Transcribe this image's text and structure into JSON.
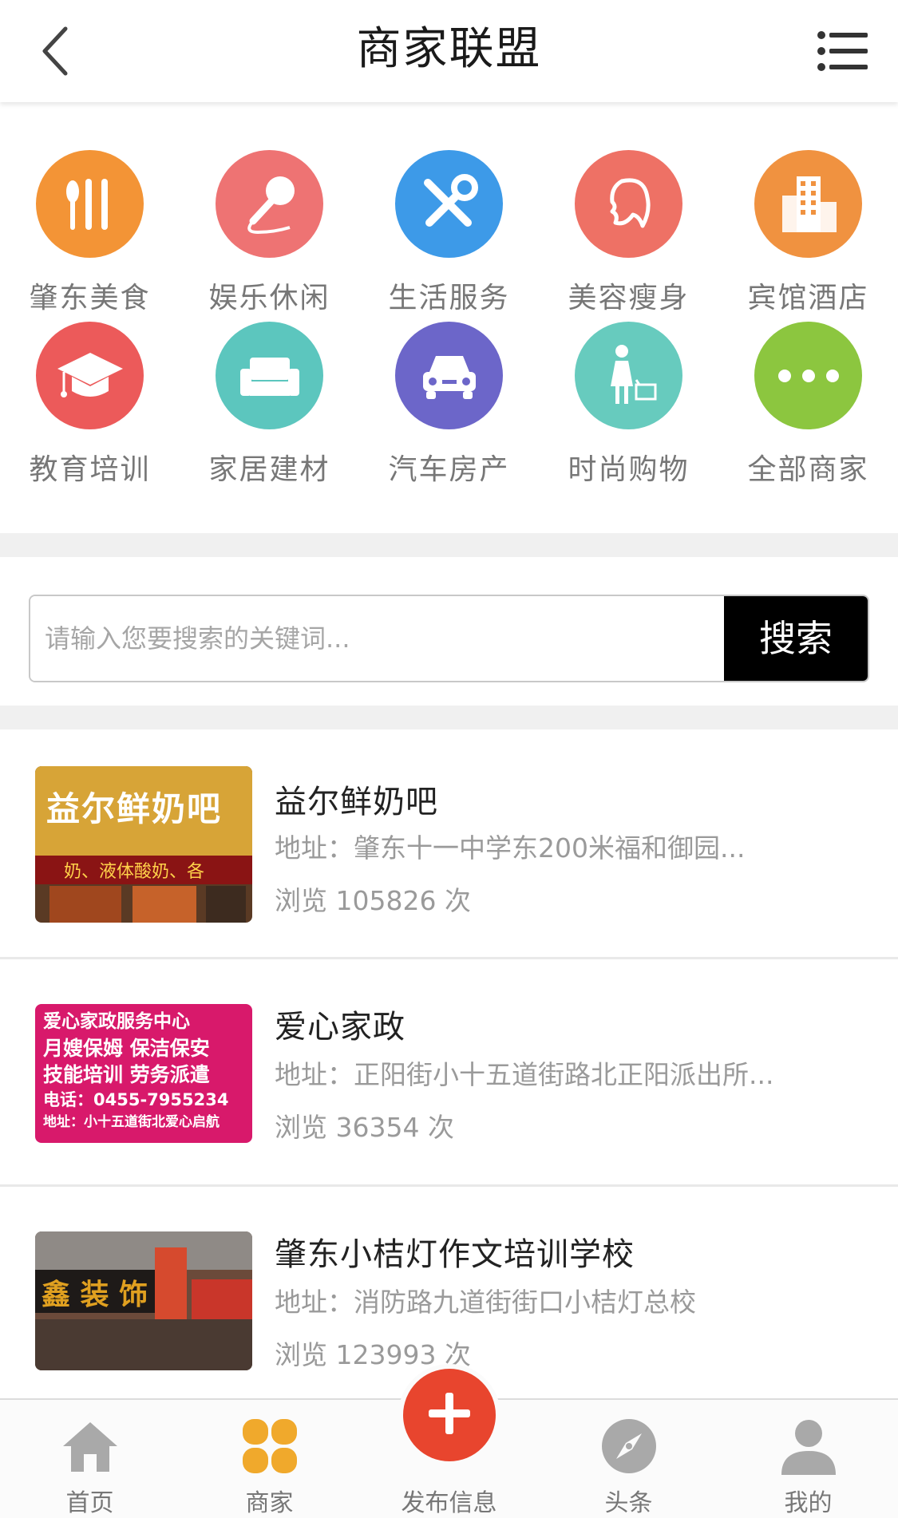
{
  "header": {
    "title": "商家联盟",
    "back_icon": "back-arrow-icon",
    "menu_icon": "list-menu-icon"
  },
  "categories": [
    {
      "label": "肇东美食",
      "icon": "fork-knife-icon",
      "color": "#F39436"
    },
    {
      "label": "娱乐休闲",
      "icon": "microphone-icon",
      "color": "#EE7373"
    },
    {
      "label": "生活服务",
      "icon": "tools-icon",
      "color": "#3D9AE8"
    },
    {
      "label": "美容瘦身",
      "icon": "face-profile-icon",
      "color": "#EE7165"
    },
    {
      "label": "宾馆酒店",
      "icon": "building-icon",
      "color": "#F09240"
    },
    {
      "label": "教育培训",
      "icon": "graduation-cap-icon",
      "color": "#EC5A5A"
    },
    {
      "label": "家居建材",
      "icon": "sofa-icon",
      "color": "#5CC6BE"
    },
    {
      "label": "汽车房产",
      "icon": "car-icon",
      "color": "#6C66C9"
    },
    {
      "label": "时尚购物",
      "icon": "shopper-icon",
      "color": "#67CBBE"
    },
    {
      "label": "全部商家",
      "icon": "more-dots-icon",
      "color": "#8CC63F"
    }
  ],
  "search": {
    "placeholder": "请输入您要搜索的关键词...",
    "button_label": "搜索"
  },
  "listings": [
    {
      "name": "益尔鲜奶吧",
      "address": "地址：肇东十一中学东200米福和御园...",
      "views": "浏览 105826 次",
      "thumb_sign": "益尔鲜奶吧",
      "thumb_banner": "奶、液体酸奶、各"
    },
    {
      "name": "爱心家政",
      "address": "地址：正阳街小十五道街路北正阳派出所...",
      "views": "浏览 36354 次",
      "thumb_lines": [
        "爱心家政服务中心",
        "月嫂保姆  保洁保安",
        "技能培训  劳务派遣",
        "电话：0455-7955234",
        "地址：小十五道街北爱心启航"
      ]
    },
    {
      "name": "肇东小桔灯作文培训学校",
      "address": "地址：消防路九道街街口小桔灯总校",
      "views": "浏览 123993 次",
      "thumb_sign": "鑫 装 饰"
    }
  ],
  "tabbar": {
    "items": [
      {
        "label": "首页",
        "icon": "home-icon"
      },
      {
        "label": "商家",
        "icon": "clover-icon"
      },
      {
        "label": "发布信息",
        "icon": "plus-icon"
      },
      {
        "label": "头条",
        "icon": "compass-icon"
      },
      {
        "label": "我的",
        "icon": "user-icon"
      }
    ],
    "accent": "#E8452E",
    "active_color": "#F0A92C"
  }
}
